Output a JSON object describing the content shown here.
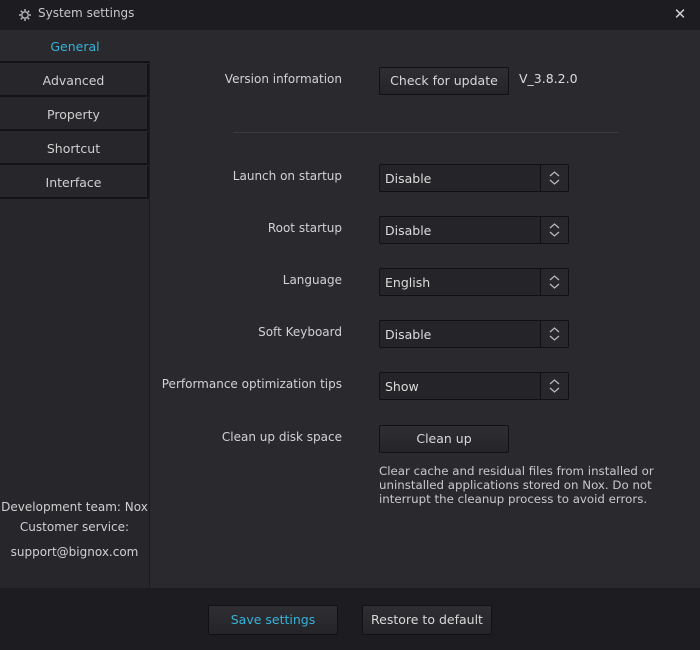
{
  "window": {
    "title": "System settings",
    "icon": "gear-icon",
    "close_icon": "close-icon"
  },
  "sidebar": {
    "items": [
      {
        "label": "General",
        "active": true
      },
      {
        "label": "Advanced",
        "active": false
      },
      {
        "label": "Property",
        "active": false
      },
      {
        "label": "Shortcut",
        "active": false
      },
      {
        "label": "Interface",
        "active": false
      }
    ],
    "info": {
      "dev_team": "Development team: Nox",
      "customer_service": "Customer service:",
      "email": "support@bignox.com"
    }
  },
  "general": {
    "version_label": "Version information",
    "check_update_label": "Check for update",
    "version": "V_3.8.2.0",
    "settings": [
      {
        "label": "Launch on startup",
        "value": "Disable"
      },
      {
        "label": "Root startup",
        "value": "Disable"
      },
      {
        "label": "Language",
        "value": "English"
      },
      {
        "label": "Soft Keyboard",
        "value": "Disable"
      },
      {
        "label": "Performance optimization tips",
        "value": "Show"
      }
    ],
    "cleanup_label": "Clean up disk space",
    "cleanup_button": "Clean up",
    "cleanup_desc": "Clear cache and residual files from installed or uninstalled applications stored on Nox. Do not interrupt the cleanup process to avoid errors."
  },
  "footer": {
    "save_label": "Save settings",
    "restore_label": "Restore to default"
  },
  "colors": {
    "accent": "#35b3d8",
    "background": "#2a292e",
    "titlebar": "#1d1c21"
  }
}
